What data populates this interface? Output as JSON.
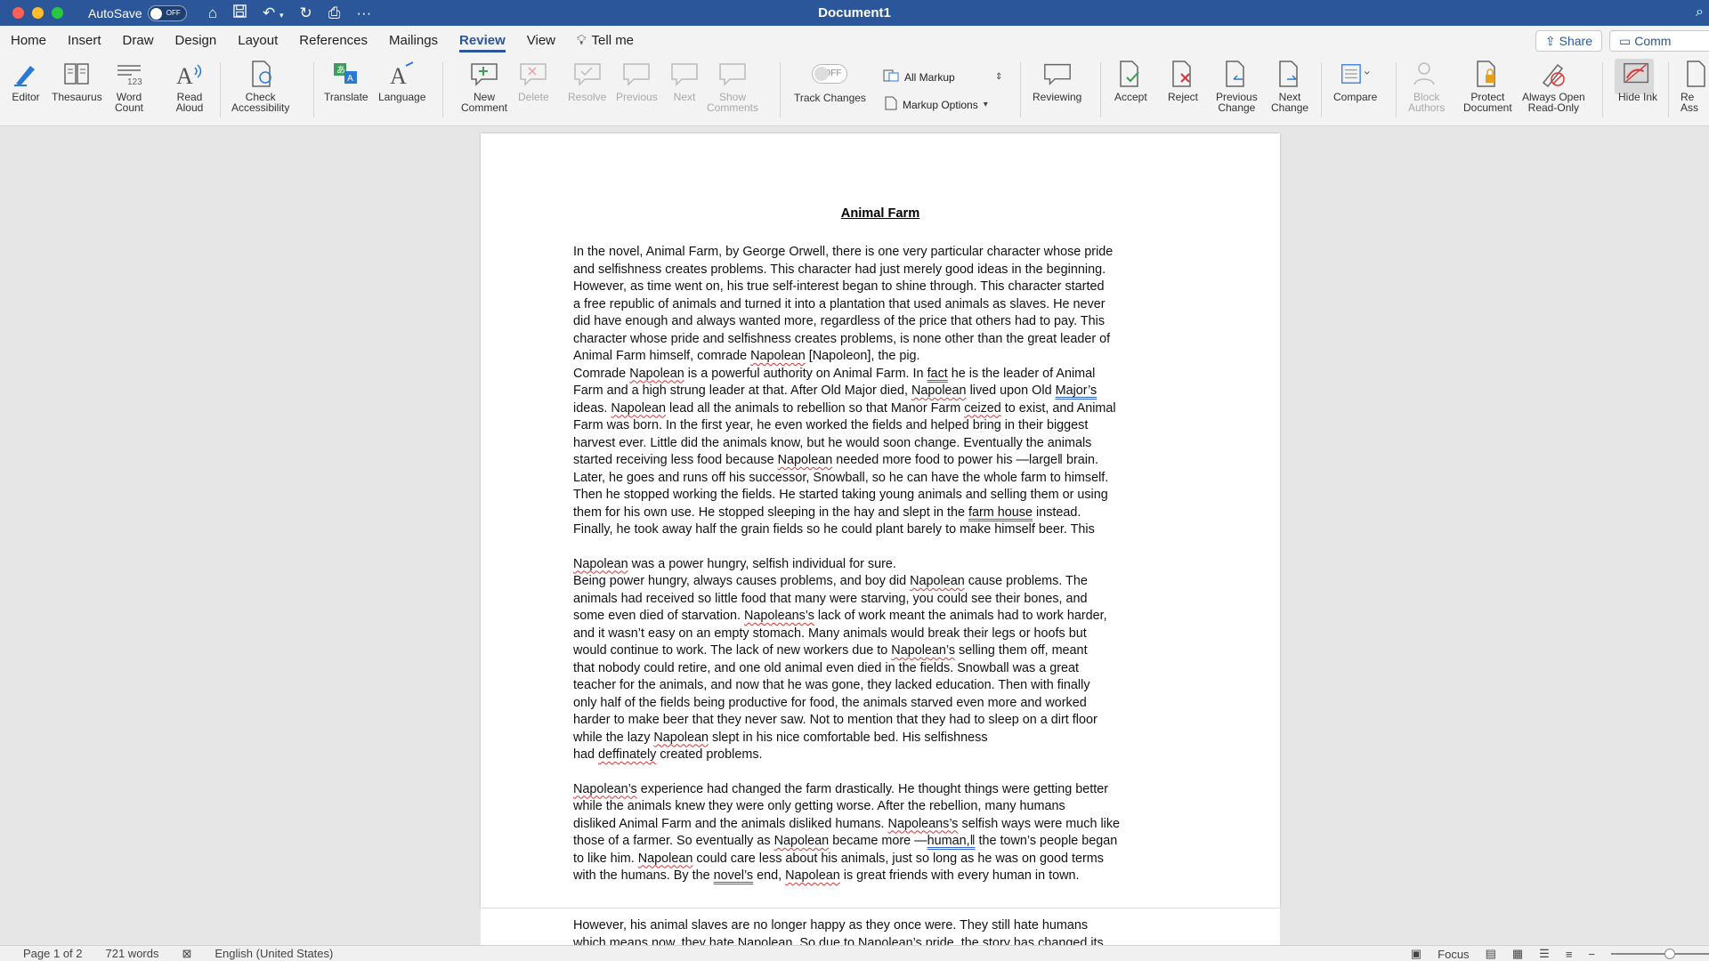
{
  "titlebar": {
    "autosave_label": "AutoSave",
    "autosave_state": "OFF",
    "document_title": "Document1"
  },
  "tabs": [
    {
      "label": "Home"
    },
    {
      "label": "Insert"
    },
    {
      "label": "Draw"
    },
    {
      "label": "Design"
    },
    {
      "label": "Layout"
    },
    {
      "label": "References"
    },
    {
      "label": "Mailings"
    },
    {
      "label": "Review",
      "active": true
    },
    {
      "label": "View"
    },
    {
      "label": "Tell me"
    }
  ],
  "header_buttons": {
    "share": "Share",
    "comments": "Comm"
  },
  "ribbon": {
    "editor": "Editor",
    "thesaurus": "Thesaurus",
    "word_count_1": "Word",
    "word_count_2": "Count",
    "read_aloud_1": "Read",
    "read_aloud_2": "Aloud",
    "check_access_1": "Check",
    "check_access_2": "Accessibility",
    "translate": "Translate",
    "language": "Language",
    "new_comment_1": "New",
    "new_comment_2": "Comment",
    "delete": "Delete",
    "resolve": "Resolve",
    "previous": "Previous",
    "next": "Next",
    "show_comments_1": "Show",
    "show_comments_2": "Comments",
    "track_state": "OFF",
    "track_changes": "Track Changes",
    "all_markup": "All Markup",
    "markup_options": "Markup Options",
    "reviewing": "Reviewing",
    "accept": "Accept",
    "reject": "Reject",
    "previous_change_1": "Previous",
    "previous_change_2": "Change",
    "next_change_1": "Next",
    "next_change_2": "Change",
    "compare": "Compare",
    "block_authors_1": "Block",
    "block_authors_2": "Authors",
    "protect_1": "Protect",
    "protect_2": "Document",
    "always_open_1": "Always Open",
    "always_open_2": "Read-Only",
    "hide_ink": "Hide Ink",
    "resume_1": "Re",
    "resume_2": "Ass"
  },
  "document": {
    "heading": "Animal Farm",
    "p1": [
      "In the novel, Animal Farm, by George Orwell, there is one very particular character whose pride",
      "and selfishness creates problems. This character had just merely good ideas in the beginning.",
      "However, as time went on, his true self-interest began to shine through. This character started",
      "a free republic of animals and turned it into a plantation that used animals as slaves. He never",
      "did have enough and always wanted more, regardless of the price that others had to pay. This",
      "character whose pride and selfishness creates problems, is none other than the great leader of"
    ],
    "p1_last_a": "Animal Farm himself, comrade ",
    "p1_last_sp": "Napolean",
    "p1_last_b": " [Napoleon], the pig.",
    "p2_1a": "Comrade ",
    "p2_1sp": "Napolean",
    "p2_1b": " is a powerful authority on Animal Farm. In ",
    "p2_1gr": "fact",
    "p2_1c": " he is the leader of Animal",
    "p2_2a": "Farm and a high strung leader at that. After Old Major died, ",
    "p2_2sp": "Napolean",
    "p2_2b": " lived upon Old ",
    "p2_2gr": "Major’s",
    "p2_3a": "ideas. ",
    "p2_3sp": "Napolean",
    "p2_3b": " lead all the animals to rebellion so that Manor Farm ",
    "p2_3sp2": "ceized",
    "p2_3c": " to exist, and Animal",
    "p2_4": "Farm was born. In the first year, he even worked the fields and helped bring in their biggest",
    "p2_5": "harvest ever. Little did the animals know, but he would soon change. Eventually the animals",
    "p2_6a": "started receiving less food because ",
    "p2_6sp": "Napolean",
    "p2_6b": " needed more food to power his —large‖ brain.",
    "p2_7": "Later, he goes and runs off his successor, Snowball, so he can have the whole farm to himself.",
    "p2_8": "Then he stopped working the fields. He started taking young animals and selling them or using",
    "p2_9a": "them for his own use. He stopped sleeping in the hay and slept in the ",
    "p2_9gr": "farm house",
    "p2_9b": " instead.",
    "p2_10": "Finally, he took away half the grain fields so he could plant barely to make himself beer. This",
    "p3_a_sp": "Napolean",
    "p3_a": " was a power hungry, selfish individual for sure.",
    "p4_1a": "Being power hungry, always causes problems, and boy did ",
    "p4_1sp": "Napolean",
    "p4_1b": " cause problems. The",
    "p4_2": "animals had received so little food that many were starving, you could see their bones, and",
    "p4_3a": "some even died of starvation. ",
    "p4_3sp": "Napoleans’s",
    "p4_3b": " lack of work meant the animals had to work harder,",
    "p4_4": "and it wasn’t easy on an empty stomach. Many animals would break their legs or hoofs but",
    "p4_5a": "would continue to work. The lack of new workers due to ",
    "p4_5sp": "Napolean’s",
    "p4_5b": " selling them off, meant",
    "p4_6": "that nobody could retire, and one old animal even died in the fields. Snowball was a great",
    "p4_7": "teacher for the animals, and now that he was gone, they lacked education. Then with finally",
    "p4_8": "only half of the fields being productive for food, the animals starved even more and worked",
    "p4_9": "harder to make beer that they never saw. Not to mention that they had to sleep on a dirt floor",
    "p4_10a": "while the lazy ",
    "p4_10sp": "Napolean",
    "p4_10b": " slept in his nice comfortable bed. His selfishness",
    "p4_11a": "had ",
    "p4_11sp": "deffinately",
    "p4_11b": " created problems.",
    "p5_1sp": "Napolean’s",
    "p5_1": " experience had changed the farm drastically. He thought things were getting better",
    "p5_2": "while the animals knew they were only getting worse. After the rebellion, many humans",
    "p5_3a": "disliked Animal Farm and the animals disliked humans. ",
    "p5_3sp": "Napoleans’s",
    "p5_3b": " selfish ways were much like",
    "p5_4a": "those of a farmer. So eventually as ",
    "p5_4sp": "Napolean",
    "p5_4b": " became more —",
    "p5_4gr": "human,‖",
    "p5_4c": " the town’s people began",
    "p5_5a": "to like him. ",
    "p5_5sp": "Napolean",
    "p5_5b": " could care less about his animals, just so long as he was on good terms",
    "p5_6a": "with the humans. By the ",
    "p5_6gr": "novel’s",
    "p5_6b": " end, ",
    "p5_6sp": "Napolean",
    "p5_6c": " is great friends with every human in town.",
    "page2_1": "However, his animal slaves are no longer happy as they once were. They still hate humans",
    "page2_2": "which means now, they hate Napolean. So due to Napolean’s pride, the story has changed its"
  },
  "statusbar": {
    "page": "Page 1 of 2",
    "words": "721 words",
    "language": "English (United States)",
    "focus": "Focus"
  },
  "colors": {
    "brand": "#2b579a",
    "spelling": "#d33",
    "grammar": "#3264d3"
  }
}
